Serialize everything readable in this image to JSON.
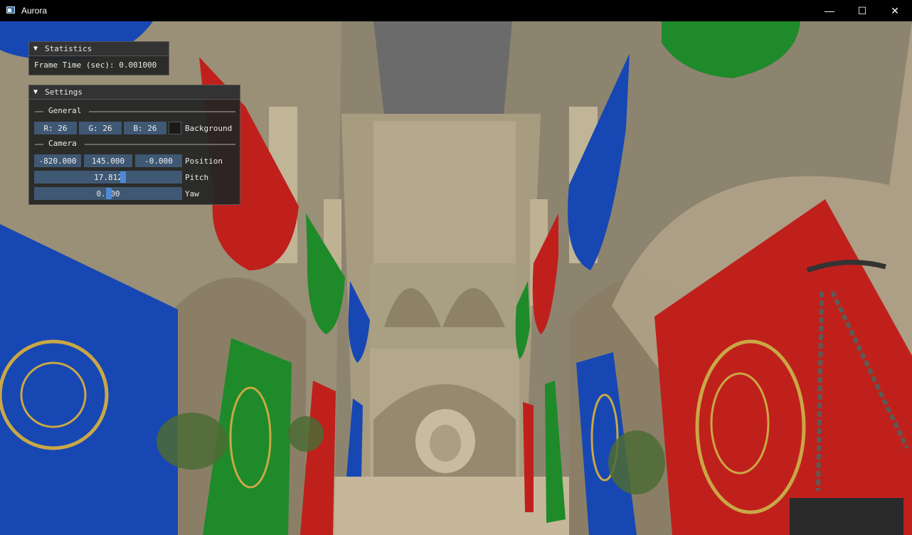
{
  "window": {
    "title": "Aurora",
    "icon": "app-window-icon",
    "controls": {
      "minimize": "—",
      "maximize": "☐",
      "close": "✕"
    }
  },
  "statistics": {
    "header": "Statistics",
    "frame_time_label": "Frame Time (sec): 0.001000"
  },
  "settings": {
    "header": "Settings",
    "general": {
      "section_label": "General",
      "r": "R: 26",
      "g": "G: 26",
      "b": "B: 26",
      "background_label": "Background"
    },
    "camera": {
      "section_label": "Camera",
      "position": [
        "-820.000",
        "145.000",
        "-0.000"
      ],
      "position_label": "Position",
      "pitch_value": "17.812",
      "pitch_label": "Pitch",
      "yaw_value": "0.000",
      "yaw_label": "Yaw"
    }
  },
  "colors": {
    "panel_bg": "#242424",
    "field_bg": "#3f5873",
    "highlight": "#4d8ad6",
    "banner_red": "#c0201c",
    "banner_blue": "#1747b3",
    "banner_green": "#1f8a2a",
    "stone": "#b7a88a"
  }
}
